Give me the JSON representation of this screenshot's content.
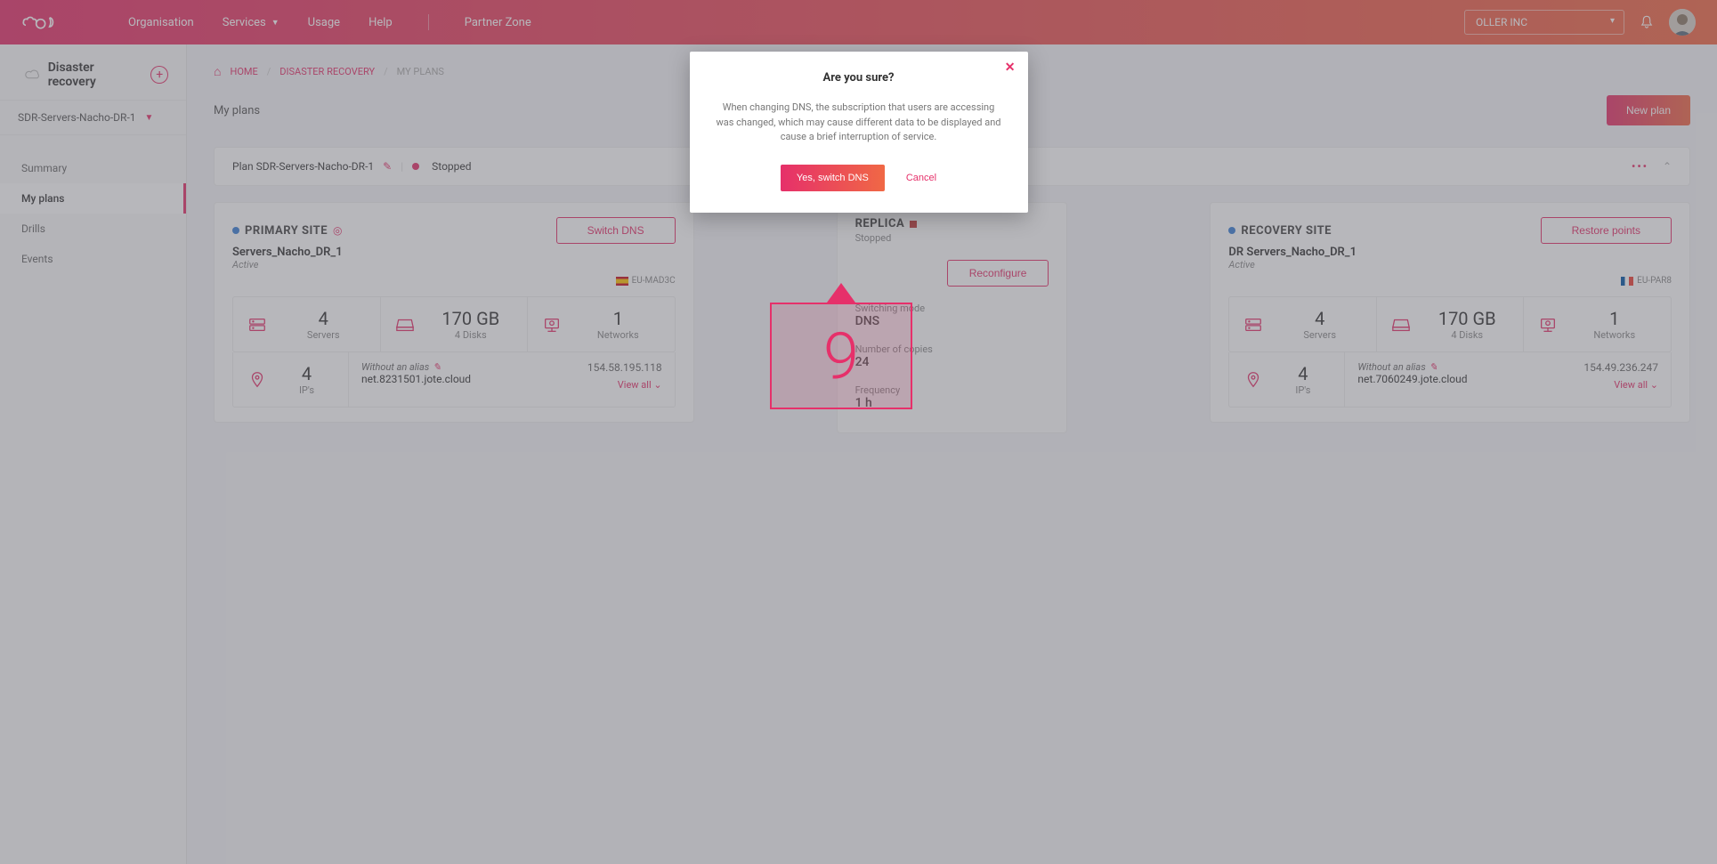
{
  "topnav": {
    "items": [
      "Organisation",
      "Services",
      "Usage",
      "Help"
    ],
    "partner": "Partner Zone",
    "tenant": "OLLER INC"
  },
  "sidebar": {
    "title": "Disaster recovery",
    "subscription": "SDR-Servers-Nacho-DR-1",
    "items": [
      "Summary",
      "My plans",
      "Drills",
      "Events"
    ],
    "active": 1
  },
  "breadcrumb": {
    "home": "HOME",
    "mid": "DISASTER RECOVERY",
    "current": "MY PLANS"
  },
  "page": {
    "title": "My plans",
    "newPlanBtn": "New plan"
  },
  "planBar": {
    "name": "Plan SDR-Servers-Nacho-DR-1",
    "status": "Stopped"
  },
  "primary": {
    "kind": "PRIMARY SITE",
    "name": "Servers_Nacho_DR_1",
    "status": "Active",
    "switchBtn": "Switch DNS",
    "region": "EU-MAD3C",
    "stats": {
      "servers": "4",
      "disksVal": "170 GB",
      "disksSub": "4 Disks",
      "networks": "1"
    },
    "ipsCount": "4",
    "ipsLabel": "IP's",
    "aliasLabel": "Without an alias",
    "alias": "net.8231501.jote.cloud",
    "ip": "154.58.195.118",
    "viewAll": "View all"
  },
  "recovery": {
    "kind": "RECOVERY SITE",
    "name": "DR Servers_Nacho_DR_1",
    "status": "Active",
    "restoreBtn": "Restore points",
    "region": "EU-PAR8",
    "stats": {
      "servers": "4",
      "disksVal": "170 GB",
      "disksSub": "4 Disks",
      "networks": "1"
    },
    "ipsCount": "4",
    "ipsLabel": "IP's",
    "aliasLabel": "Without an alias",
    "alias": "net.7060249.jote.cloud",
    "ip": "154.49.236.247",
    "viewAll": "View all"
  },
  "replica": {
    "kind": "REPLICA",
    "status": "Stopped",
    "reconfigureBtn": "Reconfigure",
    "modeLabel": "Switching mode",
    "modeValue": "DNS",
    "copiesLabel": "Number of copies",
    "copiesValue": "24",
    "freqLabel": "Frequency",
    "freqValue": "1 h"
  },
  "labels": {
    "servers": "Servers",
    "networks": "Networks"
  },
  "modal": {
    "title": "Are you sure?",
    "body": "When changing DNS, the subscription that users are accessing was changed, which may cause different data to be displayed and cause a brief interruption of service.",
    "confirm": "Yes, switch DNS",
    "cancel": "Cancel"
  },
  "annotation": {
    "num": "9"
  }
}
